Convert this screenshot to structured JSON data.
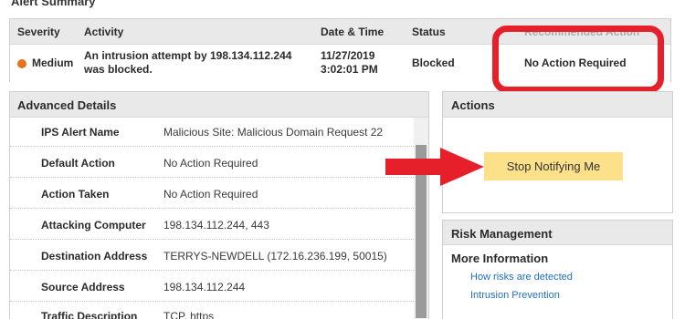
{
  "section_title": "Alert Summary",
  "summary": {
    "headers": {
      "severity": "Severity",
      "activity": "Activity",
      "datetime": "Date & Time",
      "status": "Status",
      "recommended": "Recommended Action"
    },
    "row": {
      "severity": "Medium",
      "activity_line1": "An intrusion attempt by 198.134.112.244",
      "activity_line2": "was blocked.",
      "date": "11/27/2019",
      "time": "3:02:01 PM",
      "status": "Blocked",
      "recommended": "No Action Required"
    },
    "severity_color": "#e8711f"
  },
  "advanced": {
    "title": "Advanced Details",
    "rows": [
      {
        "key": "IPS Alert Name",
        "value": "Malicious Site: Malicious Domain Request 22"
      },
      {
        "key": "Default Action",
        "value": "No Action Required"
      },
      {
        "key": "Action Taken",
        "value": "No Action Required"
      },
      {
        "key": "Attacking Computer",
        "value": "198.134.112.244, 443"
      },
      {
        "key": "Destination Address",
        "value": "TERRYS-NEWDELL (172.16.236.199, 50015)"
      },
      {
        "key": "Source Address",
        "value": "198.134.112.244"
      },
      {
        "key": "Traffic Description",
        "value": "TCP, https"
      }
    ]
  },
  "actions": {
    "title": "Actions",
    "button": "Stop Notifying Me"
  },
  "risk": {
    "title": "Risk Management",
    "subtitle": "More Information",
    "links": [
      "How risks are detected",
      "Intrusion Prevention"
    ]
  },
  "colors": {
    "callout": "#e6202b",
    "button": "#fde08a",
    "link": "#1f6fc5"
  }
}
